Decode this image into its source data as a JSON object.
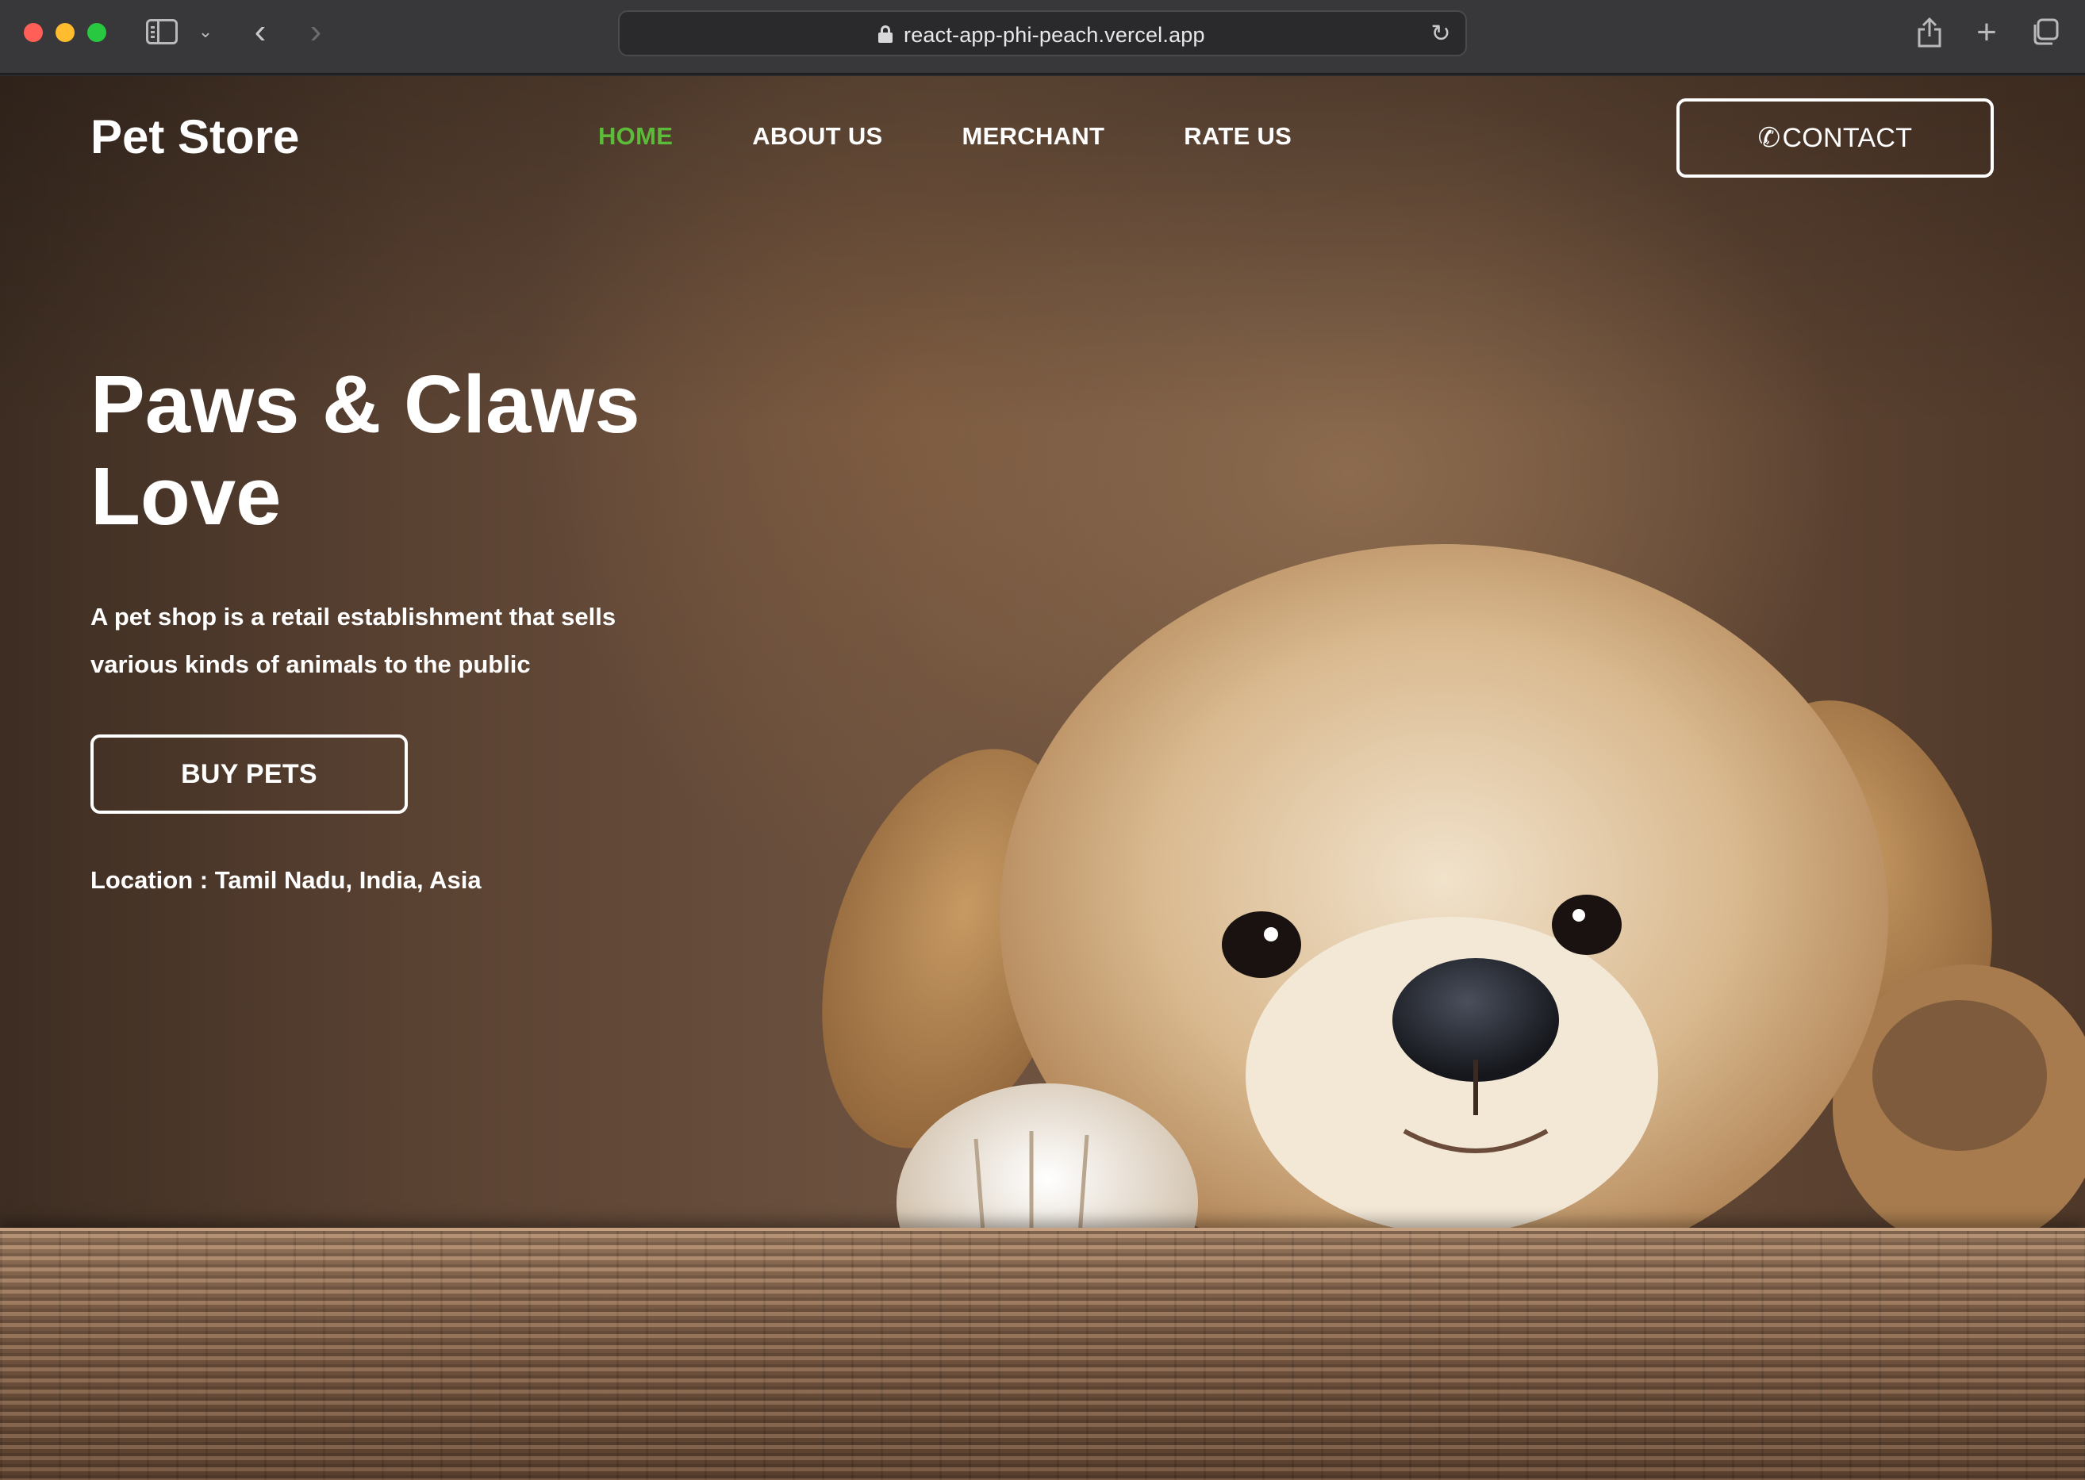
{
  "browser": {
    "url": "react-app-phi-peach.vercel.app"
  },
  "nav": {
    "brand": "Pet Store",
    "links": [
      "HOME",
      "ABOUT US",
      "MERCHANT",
      "RATE US"
    ],
    "active": "HOME",
    "contact_label": "CONTACT"
  },
  "hero": {
    "title_line1": "Paws & Claws",
    "title_line2": "Love",
    "description": "A pet shop is a retail establishment that sells various kinds of animals to the public",
    "cta_label": "BUY PETS",
    "location": "Location : Tamil Nadu, India, Asia"
  },
  "colors": {
    "accent": "#5dbb3a",
    "text": "#ffffff"
  },
  "icons": {
    "contact": "phone-icon",
    "address_bar": "lock-icon"
  }
}
